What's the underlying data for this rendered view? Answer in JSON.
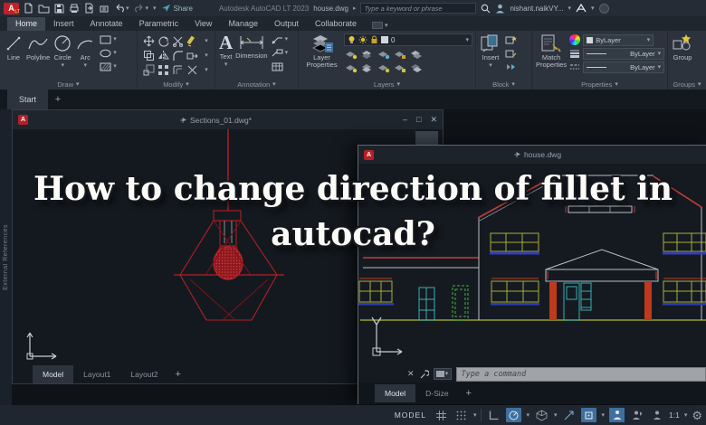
{
  "colors": {
    "accent_blue": "#3f6f9f",
    "autocad_logo_red": "#c2202a",
    "drawing_red": "#b32025",
    "titlebar_bg": "#262c36",
    "ribbon_bg": "#2d333d",
    "canvas_bg": "#14191f",
    "command_bar_bg": "#a0a4a9",
    "house_window_bg": "#151a21",
    "overlay_text": "#fbfbf8",
    "window_yellow": "#a8ad35",
    "window_sill_blue": "#2e3bc0",
    "door_teal": "#3aacb4",
    "door_green_dashed": "#46b236",
    "column_red": "#c0391d"
  },
  "icons": {
    "dropdown": "▾",
    "close": "✕",
    "minimize": "–",
    "maximize": "□",
    "plus": "+",
    "flyout": "▸",
    "acad_a": "A",
    "acad_lt": "LT",
    "text_tool": "A",
    "gear": "⚙"
  },
  "titlebar": {
    "share_label": "Share",
    "app_title": "Autodesk AutoCAD LT 2023",
    "doc_title": "house.dwg",
    "search_placeholder": "Type a keyword or phrase",
    "user_name": "nishant.naikVY..."
  },
  "ribbon": {
    "tabs": [
      {
        "label": "Home"
      },
      {
        "label": "Insert"
      },
      {
        "label": "Annotate"
      },
      {
        "label": "Parametric"
      },
      {
        "label": "View"
      },
      {
        "label": "Manage"
      },
      {
        "label": "Output"
      },
      {
        "label": "Collaborate"
      }
    ],
    "draw": {
      "label": "Draw",
      "line": "Line",
      "polyline": "Polyline",
      "circle": "Circle",
      "arc": "Arc"
    },
    "modify": {
      "label": "Modify"
    },
    "annotation": {
      "label": "Annotation",
      "text": "Text",
      "dimension": "Dimension"
    },
    "layers": {
      "label": "Layers",
      "layer_properties": "Layer Properties",
      "current_layer": "0"
    },
    "block": {
      "label": "Block",
      "insert": "Insert"
    },
    "properties": {
      "label": "Properties",
      "match_properties": "Match Properties",
      "color_value": "ByLayer",
      "lineweight_value": "ByLayer",
      "linetype_value": "ByLayer"
    },
    "groups": {
      "label": "Groups",
      "group": "Group"
    }
  },
  "file_tabs": {
    "start": "Start"
  },
  "side_palette": {
    "label": "External References"
  },
  "sections_window": {
    "title": "Sections_01.dwg*",
    "tab_model": "Model",
    "tab_layout1": "Layout1",
    "tab_layout2": "Layout2"
  },
  "house_window": {
    "title": "house.dwg",
    "command_placeholder": "Type a command",
    "tab_model": "Model",
    "tab_dsize": "D-Size"
  },
  "overlay": {
    "question": "How to change direction of fillet in autocad?",
    "line1": "How to change direction of fillet in",
    "line2": "autocad?"
  },
  "statusbar": {
    "model_label": "MODEL",
    "annotation_scale": "1:1"
  }
}
